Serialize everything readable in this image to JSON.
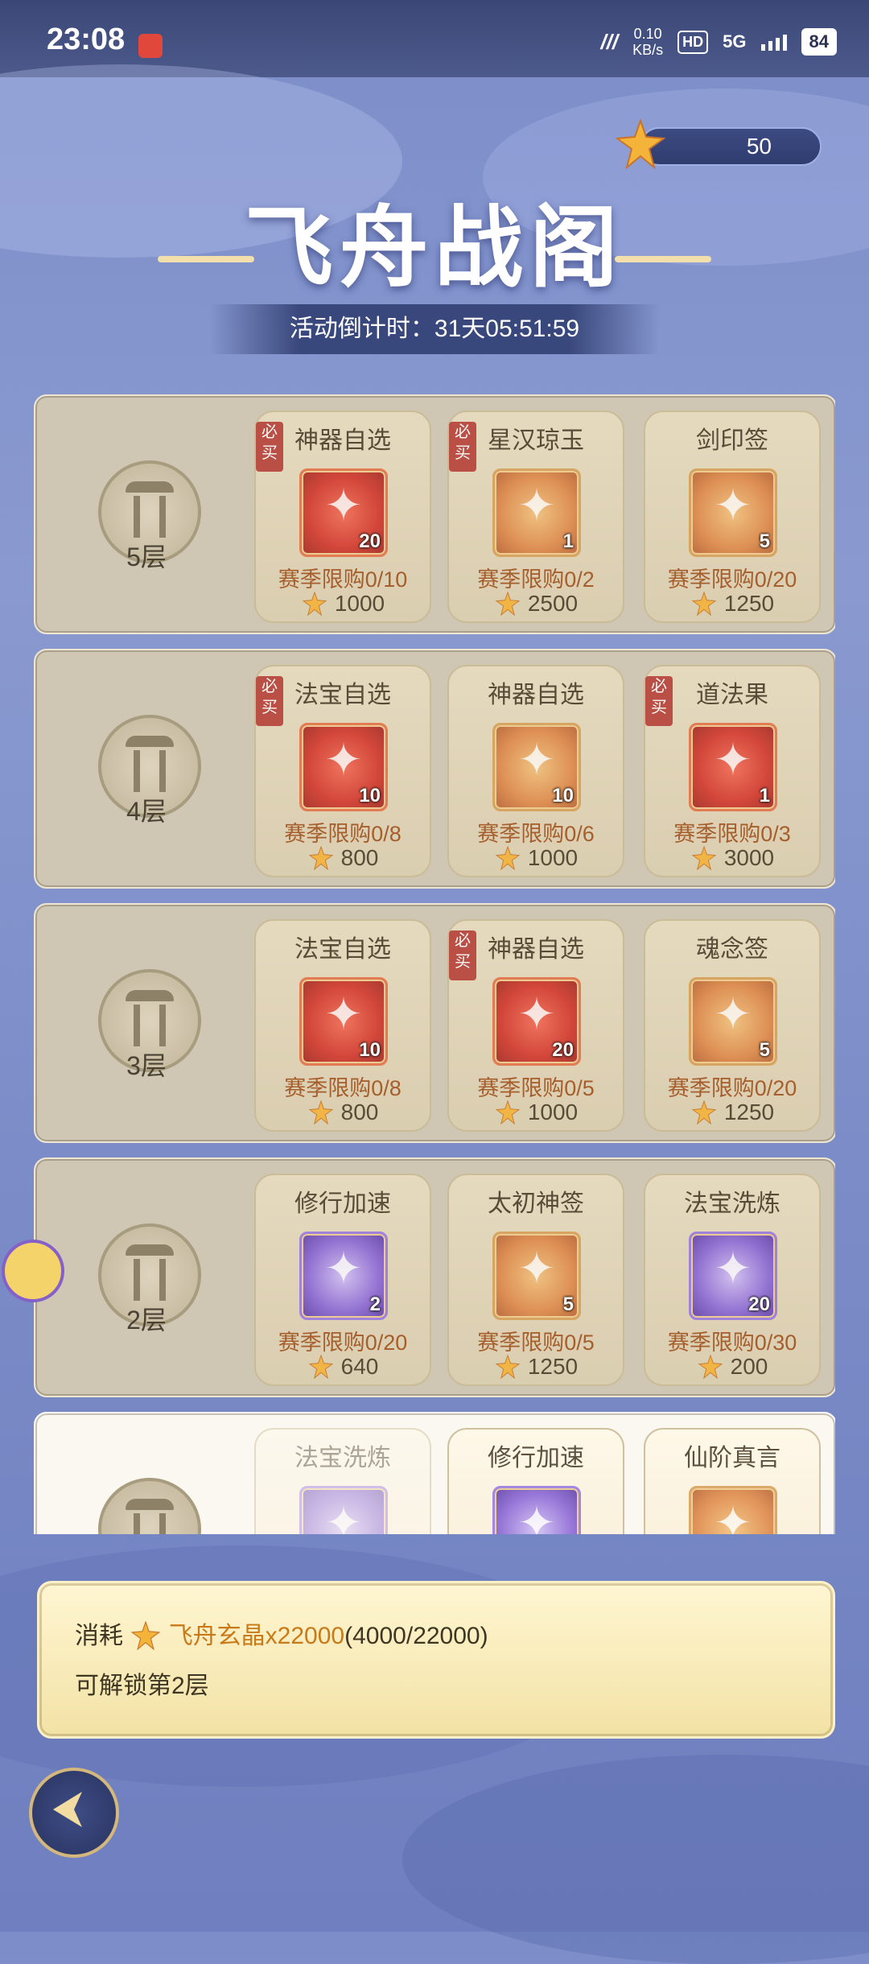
{
  "status_bar": {
    "time": "23:08",
    "net_speed_top": "0.10",
    "net_speed_unit": "KB/s",
    "hd": "HD",
    "network": "5G",
    "battery": "84"
  },
  "currency": {
    "value": "50",
    "icon": "star-crystal-icon"
  },
  "title": "飞舟战阁",
  "countdown": "活动倒计时：31天05:51:59",
  "floors": [
    {
      "label": "5层",
      "cards": [
        {
          "title": "神器自选",
          "must_buy": "必买",
          "count": "20",
          "limit": "赛季限购0/10",
          "price": "1000",
          "style": "red"
        },
        {
          "title": "星汉琼玉",
          "must_buy": "必买",
          "count": "1",
          "limit": "赛季限购0/2",
          "price": "2500",
          "style": "orange"
        },
        {
          "title": "剑印签",
          "must_buy": "",
          "count": "5",
          "limit": "赛季限购0/20",
          "price": "1250",
          "style": "orange"
        }
      ]
    },
    {
      "label": "4层",
      "cards": [
        {
          "title": "法宝自选",
          "must_buy": "必买",
          "count": "10",
          "limit": "赛季限购0/8",
          "price": "800",
          "style": "red"
        },
        {
          "title": "神器自选",
          "must_buy": "",
          "count": "10",
          "limit": "赛季限购0/6",
          "price": "1000",
          "style": "orange"
        },
        {
          "title": "道法果",
          "must_buy": "必买",
          "count": "1",
          "limit": "赛季限购0/3",
          "price": "3000",
          "style": "red"
        }
      ]
    },
    {
      "label": "3层",
      "cards": [
        {
          "title": "法宝自选",
          "must_buy": "",
          "count": "10",
          "limit": "赛季限购0/8",
          "price": "800",
          "style": "red"
        },
        {
          "title": "神器自选",
          "must_buy": "必买",
          "count": "20",
          "limit": "赛季限购0/5",
          "price": "1000",
          "style": "red"
        },
        {
          "title": "魂念签",
          "must_buy": "",
          "count": "5",
          "limit": "赛季限购0/20",
          "price": "1250",
          "style": "orange"
        }
      ]
    },
    {
      "label": "2层",
      "cards": [
        {
          "title": "修行加速",
          "must_buy": "",
          "count": "2",
          "limit": "赛季限购0/20",
          "price": "640",
          "style": "purple"
        },
        {
          "title": "太初神签",
          "must_buy": "",
          "count": "5",
          "limit": "赛季限购0/5",
          "price": "1250",
          "style": "orange"
        },
        {
          "title": "法宝洗炼",
          "must_buy": "",
          "count": "20",
          "limit": "赛季限购0/30",
          "price": "200",
          "style": "purple"
        }
      ]
    },
    {
      "label": "",
      "cards": [
        {
          "title": "法宝洗炼",
          "must_buy": "",
          "count": "",
          "limit": "",
          "price": "",
          "style": "purple"
        },
        {
          "title": "修行加速",
          "must_buy": "",
          "count": "",
          "limit": "",
          "price": "",
          "style": "purple"
        },
        {
          "title": "仙阶真言",
          "must_buy": "",
          "count": "",
          "limit": "",
          "price": "",
          "style": "orange"
        }
      ]
    }
  ],
  "info": {
    "prefix": "消耗",
    "item": "飞舟玄晶x22000",
    "progress": "(4000/22000)",
    "line2": "可解锁第2层"
  },
  "colors": {
    "accent_gold": "#c97a18",
    "limit_text": "#a1531e",
    "locked_bg": "#cfc6b4"
  }
}
